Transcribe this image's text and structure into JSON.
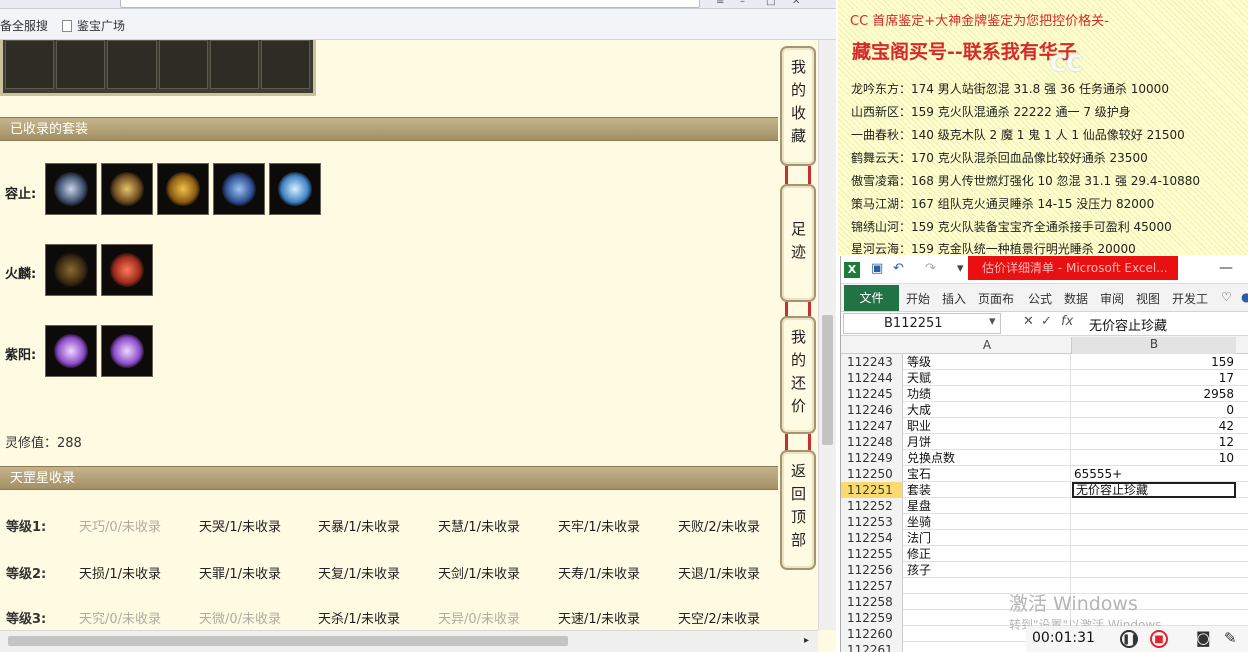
{
  "browser": {
    "bookmarks": [
      "备全服搜",
      "鉴宝广场"
    ],
    "sections": {
      "collected_title": "已收录的套装",
      "star_title": "天罡星收录"
    },
    "sets": [
      {
        "label": "容止:",
        "items": [
          "item-1",
          "item-2",
          "item-3",
          "item-4",
          "item-5"
        ]
      },
      {
        "label": "火麟:",
        "items": [
          "item-1",
          "item-2"
        ]
      },
      {
        "label": "紫阳:",
        "items": [
          "item-1",
          "item-2"
        ]
      }
    ],
    "ling_value": "灵修值：288",
    "star_levels": [
      {
        "label": "等级1:",
        "stars": [
          "天巧/0/未收录",
          "天哭/1/未收录",
          "天暴/1/未收录",
          "天慧/1/未收录",
          "天牢/1/未收录",
          "天败/2/未收录"
        ]
      },
      {
        "label": "等级2:",
        "stars": [
          "天损/1/未收录",
          "天罪/1/未收录",
          "天复/1/未收录",
          "天剑/1/未收录",
          "天寿/1/未收录",
          "天退/1/未收录"
        ]
      },
      {
        "label": "等级3:",
        "stars": [
          "天究/0/未收录",
          "天微/0/未收录",
          "天杀/1/未收录",
          "天异/0/未收录",
          "天速/1/未收录",
          "天空/2/未收录"
        ]
      }
    ],
    "side_tabs": [
      {
        "label": "我的收藏"
      },
      {
        "label": "足迹"
      },
      {
        "label": "我的还价"
      },
      {
        "label": "返回顶部"
      }
    ]
  },
  "notes": {
    "header": "CC 首席鉴定+大神金牌鉴定为您把控价格关-",
    "big": "藏宝阁买号--联系我有华子",
    "watermark": "CC",
    "lines": [
      "龙吟东方：174 男人站街忽混 31.8 强 36 任务通杀 10000",
      "山西新区：159 克火队混通杀 22222 通一 7 级护身",
      "一曲春秋：140 级克木队 2 魔 1 鬼 1 人 1 仙品像较好 21500",
      "鹤舞云天：170 克火队混杀回血品像比较好通杀 23500",
      "傲雪凌霜：168 男人传世燃灯强化 10 忽混 31.1 强 29.4-10880",
      "策马江湖：167 组队克火通灵睡杀 14-15 没压力 82000",
      "锦绣山河：159 克火队装备宝宝齐全通杀接手可盈利 45000",
      "星河云海：159 克金队统一种植景行明光睡杀 20000"
    ]
  },
  "excel": {
    "title": "估价详细清单 - Microsoft Excel...",
    "file_tab": "文件",
    "tabs": [
      "开始",
      "插入",
      "页面布",
      "公式",
      "数据",
      "审阅",
      "视图",
      "开发工"
    ],
    "name_box": "B112251",
    "formula_value": "无价容止珍藏",
    "col_a": "A",
    "col_b": "B",
    "rows": [
      {
        "n": "112243",
        "a": "等级",
        "b": "159"
      },
      {
        "n": "112244",
        "a": "天赋",
        "b": "17"
      },
      {
        "n": "112245",
        "a": "功绩",
        "b": "2958"
      },
      {
        "n": "112246",
        "a": "大成",
        "b": "0"
      },
      {
        "n": "112247",
        "a": "职业",
        "b": "42"
      },
      {
        "n": "112248",
        "a": "月饼",
        "b": "12"
      },
      {
        "n": "112249",
        "a": "兑换点数",
        "b": "10"
      },
      {
        "n": "112250",
        "a": "宝石",
        "b": "65555+"
      },
      {
        "n": "112251",
        "a": "套装",
        "b": "无价容止珍藏"
      },
      {
        "n": "112252",
        "a": "星盘",
        "b": ""
      },
      {
        "n": "112253",
        "a": "坐骑",
        "b": ""
      },
      {
        "n": "112254",
        "a": "法门",
        "b": ""
      },
      {
        "n": "112255",
        "a": "修正",
        "b": ""
      },
      {
        "n": "112256",
        "a": "孩子",
        "b": ""
      },
      {
        "n": "112257",
        "a": "",
        "b": ""
      },
      {
        "n": "112258",
        "a": "",
        "b": ""
      },
      {
        "n": "112259",
        "a": "",
        "b": ""
      },
      {
        "n": "112260",
        "a": "",
        "b": ""
      },
      {
        "n": "112261",
        "a": "",
        "b": ""
      }
    ],
    "windows_watermark_1": "激活 Windows",
    "windows_watermark_2": "转到\"设置\"以激活 Windows。"
  },
  "recorder": {
    "time": "00:01:31"
  }
}
